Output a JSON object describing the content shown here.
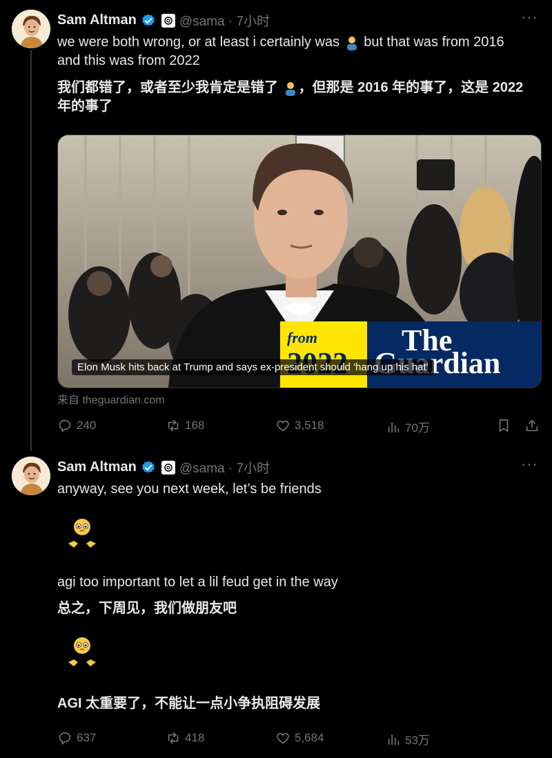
{
  "tweet1": {
    "name": "Sam Altman",
    "handle": "@sama · 7小时",
    "text_en_a": "we were both wrong, or at least i certainly was",
    "text_en_b": " but that was from 2016",
    "text_en_c": "and this was from 2022",
    "text_cn_a": "我们都错了，或者至少我肯定是错了",
    "text_cn_b": "，但那是 2016 年的事了，这是 2022",
    "text_cn_c": "年的事了",
    "card": {
      "caption": "Elon Musk hits back at Trump and says ex-president should 'hang up his hat'",
      "badge_from": "from",
      "badge_year": "2022",
      "badge_logo": "The Guardian"
    },
    "source": "来自 theguardian.com",
    "stats": {
      "replies": "240",
      "retweets": "168",
      "likes": "3,518",
      "views": "70万"
    }
  },
  "tweet2": {
    "name": "Sam Altman",
    "handle": "@sama · 7小时",
    "line1": "anyway, see you next week, let’s be friends",
    "line2": "agi too important to let a lil feud get in the way",
    "line3": "总之，下周见，我们做朋友吧",
    "line4": "AGI 太重要了，不能让一点小争执阻碍发展",
    "stats": {
      "replies": "637",
      "retweets": "418",
      "likes": "5,684",
      "views": "53万"
    }
  },
  "colors": {
    "verified": "#1d9bf0",
    "muted": "#71767b",
    "text": "#e7e9ea",
    "guardian_yellow": "#ffe500",
    "guardian_blue": "#052962"
  }
}
